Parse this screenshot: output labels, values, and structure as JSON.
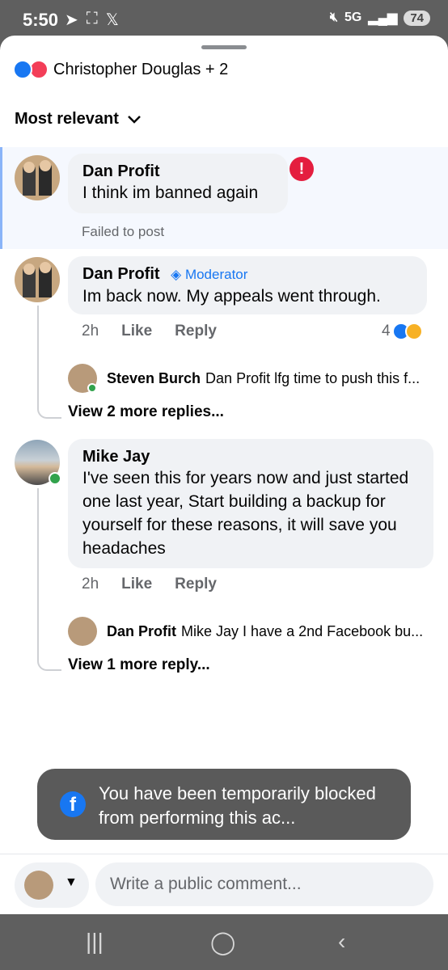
{
  "status_bar": {
    "time": "5:50",
    "network": "5G",
    "battery": "74"
  },
  "reactions_header": {
    "names": "Christopher Douglas + 2"
  },
  "sort": {
    "label": "Most relevant"
  },
  "comments": [
    {
      "author": "Dan Profit",
      "text": "I think im banned again",
      "status": "Failed to post"
    },
    {
      "author": "Dan Profit",
      "badge": "Moderator",
      "text": "Im back now.  My appeals went through.",
      "time": "2h",
      "like_label": "Like",
      "reply_label": "Reply",
      "reaction_count": "4",
      "reply_preview": {
        "author": "Steven Burch",
        "text": "Dan Profit lfg time to push this f..."
      },
      "view_more": "View 2 more replies..."
    },
    {
      "author": "Mike Jay",
      "text": "I've seen this for years now and just started one last year, Start building a backup for yourself for these reasons, it will save you headaches",
      "time": "2h",
      "like_label": "Like",
      "reply_label": "Reply",
      "reply_preview": {
        "author": "Dan Profit",
        "text": "Mike Jay I have a 2nd Facebook bu..."
      },
      "view_more": "View 1 more reply..."
    }
  ],
  "toast": {
    "message": "You have been temporarily blocked from performing this ac..."
  },
  "composer": {
    "placeholder": "Write a public comment..."
  }
}
